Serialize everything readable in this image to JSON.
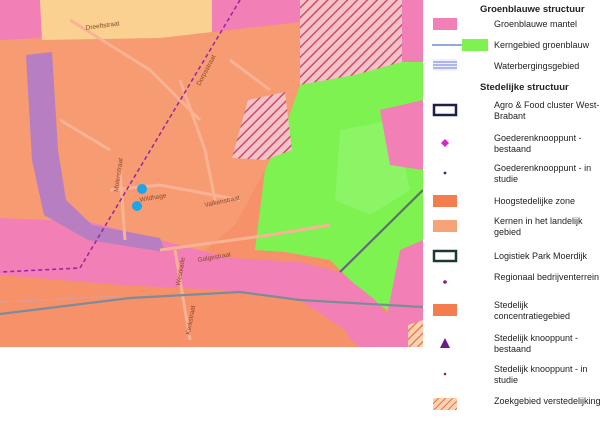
{
  "map": {
    "streets": [
      {
        "id": "street-1",
        "text": "Dreeftstraat"
      },
      {
        "id": "street-2",
        "text": "Dorpsstraat"
      },
      {
        "id": "street-3",
        "text": "Molenstraat"
      },
      {
        "id": "street-4",
        "text": "Wildhage"
      },
      {
        "id": "street-5",
        "text": "Valkenstraat"
      },
      {
        "id": "street-6",
        "text": "Galgestraat"
      },
      {
        "id": "street-7",
        "text": "Westkade"
      },
      {
        "id": "street-8",
        "text": "Kerkstraat"
      }
    ]
  },
  "legend": {
    "sections": {
      "groen": "Groenblauwe structuur",
      "stedelijk": "Stedelijke structuur"
    },
    "items": [
      {
        "label": "Groenblauwe mantel",
        "color": "#f27fb6"
      },
      {
        "label": "Kerngebied groenblauw",
        "color": "#7ef251"
      },
      {
        "label": "Waterbergingsgebied",
        "color": "#6b7bd8"
      },
      {
        "label": "Agro & Food cluster West-Brabant",
        "color": "#1c1f4a"
      },
      {
        "label": "Goederenknooppunt - bestaand",
        "color": "#e020c8"
      },
      {
        "label": "Goederenknooppunt - in studie",
        "color": "#2a2f7a"
      },
      {
        "label": "Hoogstedelijke zone",
        "color": "#f47d4e"
      },
      {
        "label": "Kernen in het landelijk gebied",
        "color": "#f6a477"
      },
      {
        "label": "Logistiek Park Moerdijk",
        "color": "#1b3a2b"
      },
      {
        "label": "Regionaal bedrijventerrein",
        "color": "#8a1f7a"
      },
      {
        "label": "Stedelijk concentratiegebied",
        "color": "#f47d4e"
      },
      {
        "label": "Stedelijk knooppunt - bestaand",
        "color": "#6a1d8a"
      },
      {
        "label": "Stedelijk knooppunt - in studie",
        "color": "#a0186a"
      },
      {
        "label": "Zoekgebied verstedelijking",
        "color": "#f47d4e"
      }
    ]
  }
}
